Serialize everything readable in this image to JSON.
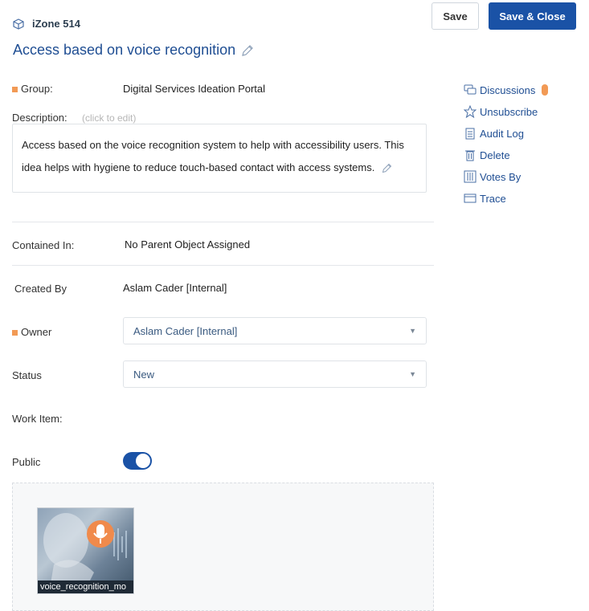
{
  "header": {
    "record_id": "iZone 514",
    "title": "Access based on voice recognition"
  },
  "toolbar": {
    "save_label": "Save",
    "save_close_label": "Save & Close"
  },
  "fields": {
    "group_label": "Group:",
    "group_value": "Digital Services Ideation Portal",
    "description_label": "Description:",
    "description_hint": "(click to edit)",
    "description_text": "Access based on the voice recognition system to help with accessibility users. This idea helps with hygiene to reduce touch-based contact with access systems.",
    "contained_label": "Contained In:",
    "contained_value": "No Parent Object Assigned",
    "created_by_label": "Created By",
    "created_by_value": "Aslam Cader [Internal]",
    "owner_label": "Owner",
    "owner_value": "Aslam Cader [Internal]",
    "status_label": "Status",
    "status_value": "New",
    "work_item_label": "Work Item:",
    "public_label": "Public",
    "public_enabled": true
  },
  "attachment": {
    "caption": "voice_recognition_mo"
  },
  "sidebar": {
    "items": [
      {
        "label": "Discussions",
        "icon": "chat-icon"
      },
      {
        "label": "Unsubscribe",
        "icon": "star-icon"
      },
      {
        "label": "Audit Log",
        "icon": "clipboard-icon"
      },
      {
        "label": "Delete",
        "icon": "trash-icon"
      },
      {
        "label": "Votes By",
        "icon": "votes-icon"
      },
      {
        "label": "Trace",
        "icon": "window-icon"
      }
    ]
  },
  "colors": {
    "accent": "#1a52a6",
    "title": "#1f4e93",
    "required_marker": "#f29a55"
  }
}
